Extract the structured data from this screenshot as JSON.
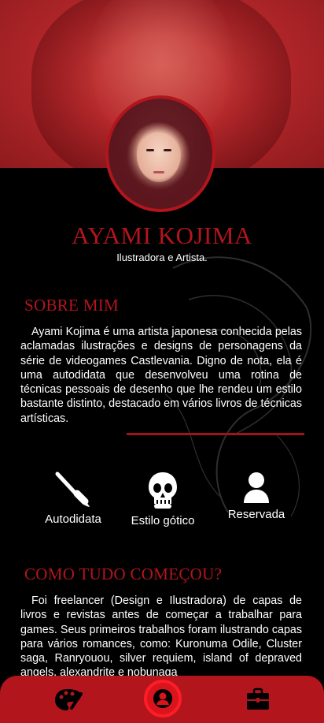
{
  "profile": {
    "name": "AYAMI KOJIMA",
    "role": "Ilustradora e Artista."
  },
  "about": {
    "title": "SOBRE MIM",
    "text": "Ayami Kojima é uma artista japonesa conhecida pelas aclamadas ilustrações e designs de personagens da série de videogames Castlevania. Digno de nota, ela é uma autodidata que desenvolveu uma rotina de técnicas pessoais de desenho que lhe rendeu um estilo bastante distinto, destacado em vários livros de técnicas artísticas."
  },
  "features": [
    {
      "label": "Autodidata",
      "icon": "paintbrush-icon"
    },
    {
      "label": "Estilo gótico",
      "icon": "skull-icon"
    },
    {
      "label": "Reservada",
      "icon": "user-icon"
    }
  ],
  "history": {
    "title": "COMO TUDO COMEÇOU?",
    "text": "Foi freelancer (Design e Ilustradora) de capas de livros e revistas antes de começar a trabalhar para games. Seus primeiros trabalhos foram ilustrando capas para vários romances, como: Kuronuma Odile, Cluster saga, Ranryouou, silver requiem, island of depraved angels, alexandrite e nobunaga"
  },
  "nav": [
    {
      "icon": "palette-icon"
    },
    {
      "icon": "profile-icon",
      "active": true
    },
    {
      "icon": "briefcase-icon"
    }
  ],
  "colors": {
    "accent": "#b3151c",
    "background": "#000000",
    "text": "#ffffff"
  }
}
